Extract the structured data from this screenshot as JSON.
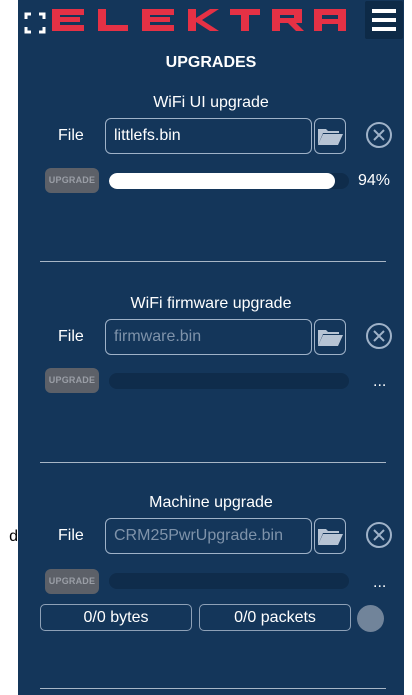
{
  "stray_text": "d",
  "header": {
    "brand": "ELEKTRA",
    "menu_icon": "hamburger-icon",
    "expand_icon": "expand-icon"
  },
  "page": {
    "title": "UPGRADES"
  },
  "sections": [
    {
      "title": "WiFi UI upgrade",
      "file_label": "File",
      "file_value": "littlefs.bin",
      "placeholder": "",
      "upgrade_label": "UPGRADE",
      "progress": 0.94,
      "progress_text": "94%"
    },
    {
      "title": "WiFi firmware upgrade",
      "file_label": "File",
      "file_value": "",
      "placeholder": "firmware.bin",
      "upgrade_label": "UPGRADE",
      "progress": 0,
      "progress_text": "..."
    },
    {
      "title": "Machine upgrade",
      "file_label": "File",
      "file_value": "",
      "placeholder": "CRM25PwrUpgrade.bin",
      "upgrade_label": "UPGRADE",
      "progress": 0,
      "progress_text": "..."
    }
  ],
  "machine_stats": {
    "bytes": "0/0 bytes",
    "packets": "0/0 packets"
  },
  "colors": {
    "background": "#14365a",
    "brand": "#e53145",
    "button_disabled": "#5c6068",
    "progress_fill": "#ffffff",
    "border": "#9fb2c8"
  }
}
